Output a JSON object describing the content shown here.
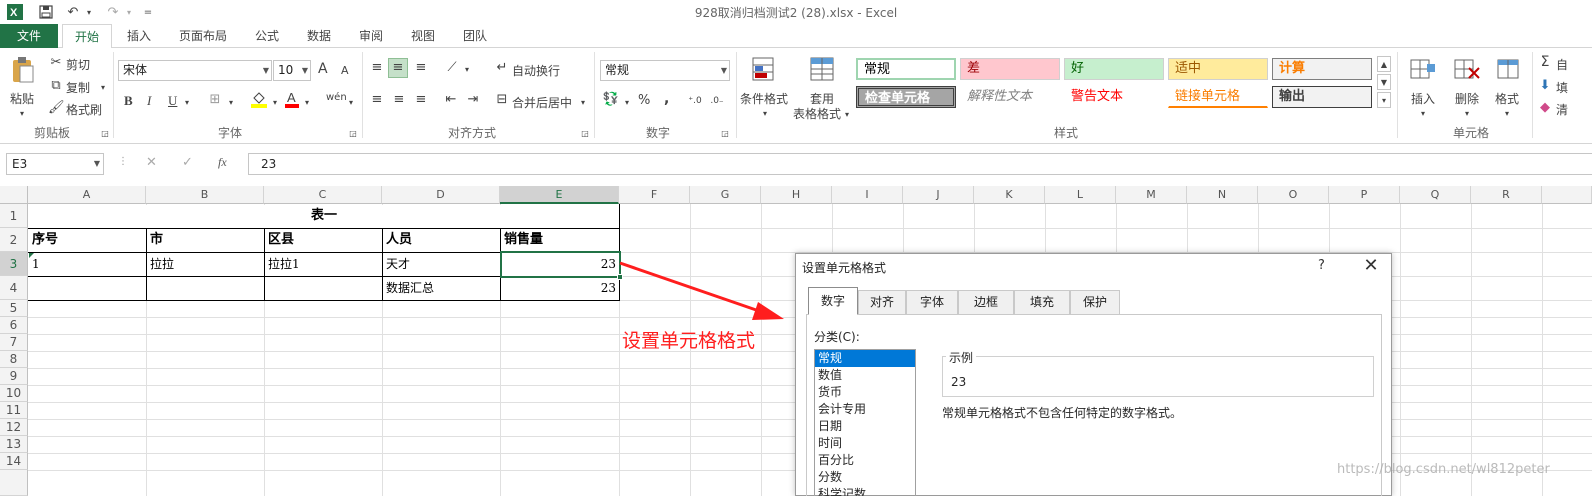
{
  "window": {
    "title": "928取消归档测试2 (28).xlsx - Excel"
  },
  "quick_access": {
    "undo_label": "↶",
    "redo_label": "↷",
    "more_label": "="
  },
  "tabs": [
    {
      "label": "文件"
    },
    {
      "label": "开始"
    },
    {
      "label": "插入"
    },
    {
      "label": "页面布局"
    },
    {
      "label": "公式"
    },
    {
      "label": "数据"
    },
    {
      "label": "审阅"
    },
    {
      "label": "视图"
    },
    {
      "label": "团队"
    }
  ],
  "ribbon": {
    "clipboard": {
      "paste": "粘贴",
      "cut": "剪切",
      "copy": "复制",
      "format_painter": "格式刷",
      "label": "剪贴板"
    },
    "font": {
      "name": "宋体",
      "size": "10",
      "grow": "A",
      "shrink": "A",
      "bold": "B",
      "italic": "I",
      "underline": "U",
      "label": "字体",
      "phonetic": "wén"
    },
    "alignment": {
      "wrap": "自动换行",
      "merge": "合并后居中",
      "label": "对齐方式"
    },
    "number": {
      "format": "常规",
      "percent": "%",
      "comma": ",",
      "label": "数字"
    },
    "styles": {
      "conditional": "条件格式",
      "table_1": "套用",
      "table_2": "表格格式",
      "cells": [
        {
          "text": "常规",
          "bg": "#ffffff",
          "fg": "#000000"
        },
        {
          "text": "差",
          "bg": "#ffc7ce",
          "fg": "#9c0006"
        },
        {
          "text": "好",
          "bg": "#c6efce",
          "fg": "#006100"
        },
        {
          "text": "适中",
          "bg": "#ffeb9c",
          "fg": "#9c5700"
        },
        {
          "text": "计算",
          "bg": "#f2f2f2",
          "fg": "#fa7d00"
        },
        {
          "text": "检查单元格",
          "bg": "#a5a5a5",
          "fg": "#ffffff"
        },
        {
          "text": "解释性文本",
          "bg": "#ffffff",
          "fg": "#7f7f7f"
        },
        {
          "text": "警告文本",
          "bg": "#ffffff",
          "fg": "#ff0000"
        },
        {
          "text": "链接单元格",
          "bg": "#ffffff",
          "fg": "#fa7d00"
        },
        {
          "text": "输出",
          "bg": "#f2f2f2",
          "fg": "#3f3f3f"
        }
      ],
      "label": "样式"
    },
    "cells": {
      "insert": "插入",
      "delete": "删除",
      "format": "格式",
      "label": "单元格"
    },
    "editing": {
      "autosum": "自",
      "fill": "填",
      "clear": "清"
    }
  },
  "formula_bar": {
    "name_box": "E3",
    "value": "23",
    "fx": "fx"
  },
  "columns": [
    "A",
    "B",
    "C",
    "D",
    "E",
    "F",
    "G",
    "H",
    "I",
    "J",
    "K",
    "L",
    "M",
    "N",
    "O",
    "P",
    "Q",
    "R"
  ],
  "rows": [
    "1",
    "2",
    "3",
    "4",
    "5",
    "6",
    "7",
    "8",
    "9",
    "10",
    "11",
    "12",
    "13",
    "14"
  ],
  "sheet": {
    "title": "表一",
    "headers": [
      "序号",
      "市",
      "区县",
      "人员",
      "销售量"
    ],
    "row3": [
      "1",
      "拉拉",
      "拉拉1",
      "天才",
      "23"
    ],
    "row4": [
      "",
      "",
      "",
      "数据汇总",
      "23"
    ]
  },
  "annotation": "设置单元格格式",
  "dialog": {
    "title": "设置单元格格式",
    "help": "?",
    "close": "✕",
    "tabs": [
      "数字",
      "对齐",
      "字体",
      "边框",
      "填充",
      "保护"
    ],
    "category_label": "分类(C):",
    "categories": [
      "常规",
      "数值",
      "货币",
      "会计专用",
      "日期",
      "时间",
      "百分比",
      "分数",
      "科学记数"
    ],
    "sample_label": "示例",
    "sample_value": "23",
    "description": "常规单元格格式不包含任何特定的数字格式。"
  },
  "watermark": "https://blog.csdn.net/wl812peter"
}
